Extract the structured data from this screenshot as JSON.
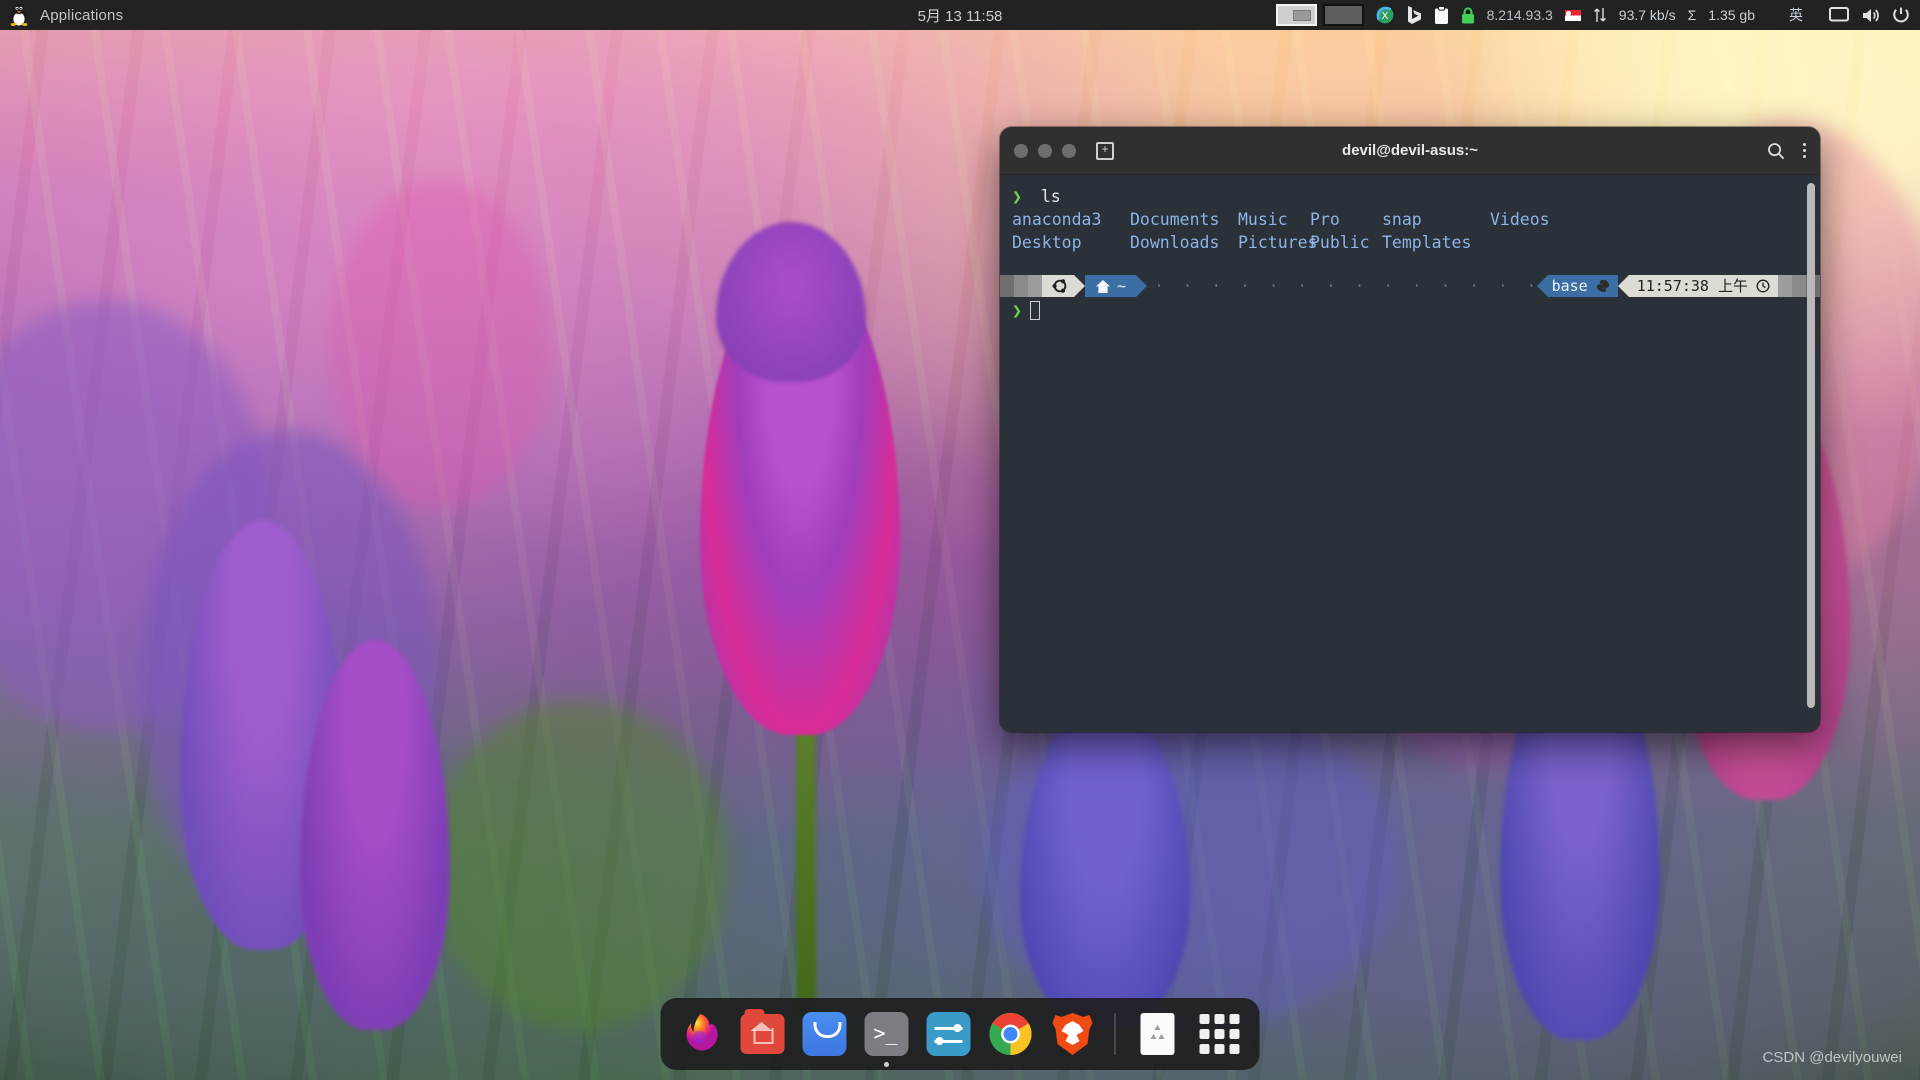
{
  "topbar": {
    "applications_label": "Applications",
    "linux_icon": "tux-icon",
    "datetime": "5月 13  11:58",
    "workspaces": [
      {
        "name": "workspace-1",
        "active": true
      },
      {
        "name": "workspace-2",
        "active": false
      }
    ],
    "tray": {
      "sync_icon": "green-circle-sync-icon",
      "bing_icon": "bing-b-icon",
      "clipboard_icon": "clipboard-icon",
      "lock_icon": "green-lock-icon",
      "ip_address": "8.214.93.3",
      "flag_icon": "singapore-flag-icon",
      "netspeed_icon": "up-down-arrows-icon",
      "net_speed": "93.7 kb/s",
      "sigma_icon": "sigma-icon",
      "data_total": "1.35 gb",
      "input_method": "英",
      "display_icon": "display-icon",
      "volume_icon": "volume-icon",
      "power_icon": "power-icon"
    }
  },
  "terminal": {
    "title": "devil@devil-asus:~",
    "titlebar_icons": {
      "close": "close-dot",
      "minimize": "minimize-dot",
      "maximize": "maximize-dot",
      "new_tab": "new-tab-icon",
      "search": "search-icon",
      "menu": "kebab-menu-icon"
    },
    "prompt_symbol": "❯",
    "command": "ls",
    "ls_output": [
      [
        "anaconda3",
        "Documents",
        "Music",
        "Pro",
        "snap",
        "Videos"
      ],
      [
        "Desktop",
        "Downloads",
        "Pictures",
        "Public",
        "Templates",
        ""
      ]
    ],
    "statusline": {
      "os_icon": "ubuntu-icon",
      "home_icon": "home-icon",
      "path": "~",
      "dots": "· · · · · · · · · · · · · · · · · · · · · · · · · · · · · · · · · · · · · · · · ·",
      "env_name": "base",
      "python_icon": "python-icon",
      "time": "11:57:38 上午",
      "clock_icon": "clock-icon"
    },
    "colors": {
      "background": "#2b3138",
      "titlebar": "#303030",
      "prompt_green": "#6fd84f",
      "dir_blue": "#8cb4e8",
      "segment_blue": "#3b6ea5",
      "segment_light": "#dcdcd4"
    }
  },
  "dock": {
    "items": [
      {
        "name": "firefox",
        "label": "Firefox",
        "running": false
      },
      {
        "name": "files",
        "label": "Files",
        "running": false
      },
      {
        "name": "software",
        "label": "Ubuntu Software",
        "running": false
      },
      {
        "name": "terminal",
        "label": "Terminal",
        "running": true
      },
      {
        "name": "settings",
        "label": "Settings",
        "running": false
      },
      {
        "name": "chrome",
        "label": "Google Chrome",
        "running": true
      },
      {
        "name": "brave",
        "label": "Brave Browser",
        "running": false
      },
      {
        "name": "trash",
        "label": "Trash",
        "running": false
      },
      {
        "name": "show-apps",
        "label": "Show Applications",
        "running": false
      }
    ]
  },
  "watermark": "CSDN @devilyouwei"
}
